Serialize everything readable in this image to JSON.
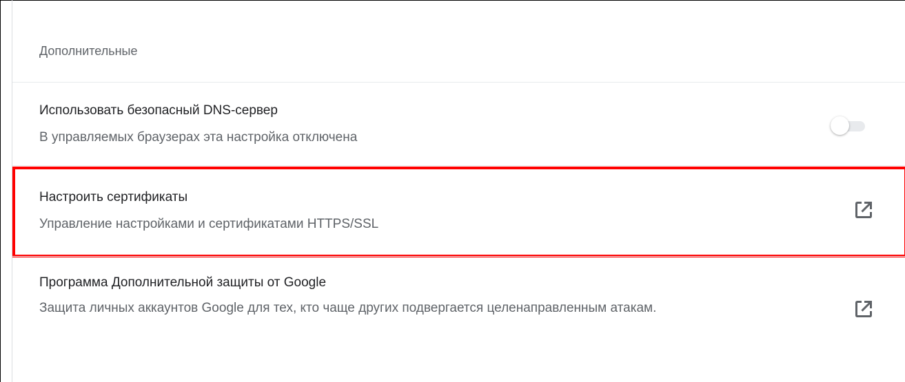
{
  "section": {
    "title": "Дополнительные"
  },
  "rows": [
    {
      "title": "Использовать безопасный DNS-сервер",
      "subtitle": "В управляемых браузерах эта настройка отключена",
      "control": "toggle",
      "toggle_state": "off",
      "toggle_disabled": true
    },
    {
      "title": "Настроить сертификаты",
      "subtitle": "Управление настройками и сертификатами HTTPS/SSL",
      "control": "external-link-icon",
      "highlighted": true
    },
    {
      "title": "Программа Дополнительной защиты от Google",
      "subtitle": "Защита личных аккаунтов Google для тех, кто чаще других подвергается целенаправленным атакам.",
      "control": "external-link-icon"
    }
  ],
  "colors": {
    "highlight": "#ff0000",
    "title_text": "#202124",
    "secondary_text": "#5f6368",
    "divider": "#e8eaed"
  }
}
